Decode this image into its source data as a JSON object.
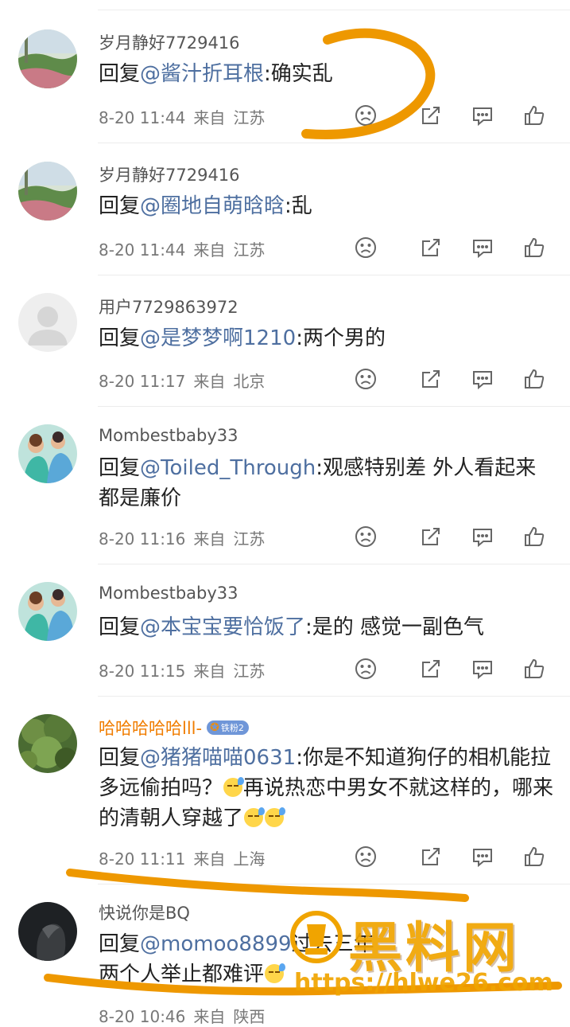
{
  "colors": {
    "mention": "#4e6fa0",
    "highlight_name": "#f07d00",
    "annotation": "#ee9800",
    "badge": "#6f96d8"
  },
  "icons": [
    "sad-face-icon",
    "share-icon",
    "comment-icon",
    "like-icon"
  ],
  "comments": [
    {
      "username": "岁月静好7729416",
      "reply_prefix": "回复",
      "mention": "@酱汁折耳根",
      "text": ":确实乱",
      "date": "8-20 11:44",
      "from": "来自",
      "location": "江苏"
    },
    {
      "username": "岁月静好7729416",
      "reply_prefix": "回复",
      "mention": "@圈地自萌晗晗",
      "text": ":乱",
      "date": "8-20 11:44",
      "from": "来自",
      "location": "江苏"
    },
    {
      "username": "用户7729863972",
      "reply_prefix": "回复",
      "mention": "@是梦梦啊1210",
      "text": ":两个男的",
      "date": "8-20 11:17",
      "from": "来自",
      "location": "北京"
    },
    {
      "username": "Mombestbaby33",
      "reply_prefix": "回复",
      "mention": "@Toiled_Through",
      "text": ":观感特别差 外人看起来  都是廉价",
      "date": "8-20 11:16",
      "from": "来自",
      "location": "江苏"
    },
    {
      "username": "Mombestbaby33",
      "reply_prefix": "回复",
      "mention": "@本宝宝要恰饭了",
      "text": ":是的 感觉一副色气",
      "date": "8-20 11:15",
      "from": "来自",
      "location": "江苏"
    },
    {
      "username": "哈哈哈哈哈lll-",
      "badge": "铁粉2",
      "reply_prefix": "回复",
      "mention": "@猪猪喵喵0631",
      "text": ":你是不知道狗仔的相机能拉多远偷拍吗？",
      "text2": "再说热恋中男女不就这样的，哪来的清朝人穿越了",
      "date": "8-20 11:11",
      "from": "来自",
      "location": "上海"
    },
    {
      "username": "快说你是BQ",
      "reply_prefix": "回复",
      "mention": "@momoo8899",
      "text": "过去三年",
      "text2": "两个人举止都难评",
      "date": "8-20 10:46",
      "from": "来自",
      "location": "陕西"
    }
  ],
  "watermark": {
    "title": "黑料网",
    "url": "https://hlwe26.com"
  }
}
